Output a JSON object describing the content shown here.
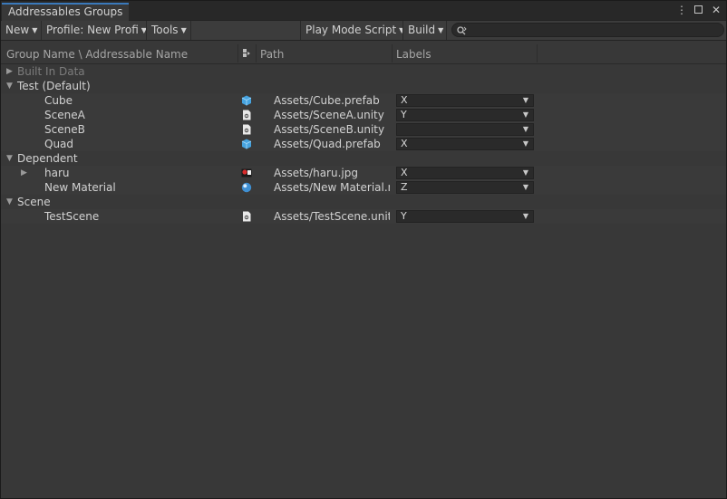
{
  "window": {
    "tab_title": "Addressables Groups",
    "menu_glyph": "⋮",
    "close_glyph": "✕"
  },
  "toolbar": {
    "new_label": "New",
    "profile_label": "Profile: New Profi",
    "tools_label": "Tools",
    "play_mode_label": "Play Mode Script",
    "build_label": "Build",
    "dropdown_glyph": "▼",
    "search_value": "",
    "search_icon": "search-icon"
  },
  "columns": {
    "name": "Group Name \\ Addressable Name",
    "path": "Path",
    "labels": "Labels"
  },
  "tree": {
    "collapsed_glyph": "▶",
    "expanded_glyph": "▼",
    "groups": [
      {
        "name": "Built In Data",
        "expanded": false,
        "disabled": true
      },
      {
        "name": "Test (Default)",
        "expanded": true
      },
      {
        "name": "Dependent",
        "expanded": true
      },
      {
        "name": "Scene",
        "expanded": true
      }
    ],
    "entries": [
      {
        "name": "Cube",
        "path": "Assets/Cube.prefab",
        "label": "X",
        "icon": "prefab-cube-icon"
      },
      {
        "name": "SceneA",
        "path": "Assets/SceneA.unity",
        "label": "Y",
        "icon": "scene-icon"
      },
      {
        "name": "SceneB",
        "path": "Assets/SceneB.unity",
        "label": "",
        "icon": "scene-icon"
      },
      {
        "name": "Quad",
        "path": "Assets/Quad.prefab",
        "label": "X",
        "icon": "prefab-cube-icon"
      },
      {
        "name": "haru",
        "path": "Assets/haru.jpg",
        "label": "X",
        "icon": "texture-icon",
        "has_children": true
      },
      {
        "name": "New Material",
        "path": "Assets/New Material.m",
        "label": "Z",
        "icon": "material-icon"
      },
      {
        "name": "TestScene",
        "path": "Assets/TestScene.unity",
        "label": "Y",
        "icon": "scene-icon"
      }
    ]
  },
  "colors": {
    "accent": "#3a79bb",
    "background": "#383838",
    "prefab_icon": "#46a3e0"
  }
}
